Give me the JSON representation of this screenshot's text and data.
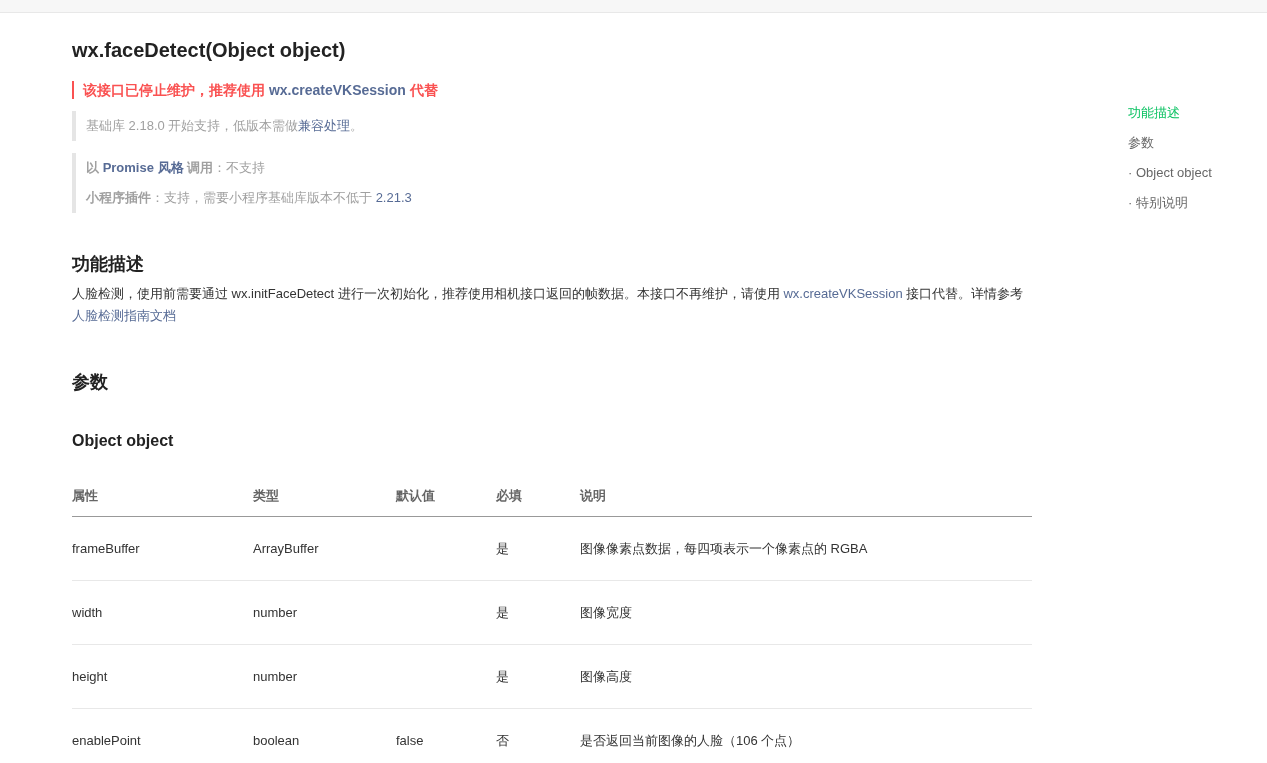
{
  "title": "wx.faceDetect(Object object)",
  "deprecation": [
    {
      "text": "该接口已停止维护，推荐使用 ",
      "kind": "text"
    },
    {
      "text": "wx.createVKSession",
      "kind": "link"
    },
    {
      "text": " 代替",
      "kind": "text"
    }
  ],
  "notes": [
    [
      [
        {
          "text": "基础库 2.18.0 开始支持，低版本需做",
          "kind": "text"
        },
        {
          "text": "兼容处理",
          "kind": "link"
        },
        {
          "text": "。",
          "kind": "text"
        }
      ]
    ],
    [
      [
        {
          "text": "以 ",
          "kind": "strong"
        },
        {
          "text": "Promise 风格",
          "kind": "strong-link"
        },
        {
          "text": " 调用",
          "kind": "strong"
        },
        {
          "text": "：不支持",
          "kind": "text"
        }
      ],
      [
        {
          "text": "小程序插件",
          "kind": "strong"
        },
        {
          "text": "：支持，需要小程序基础库版本不低于 ",
          "kind": "text"
        },
        {
          "text": "2.21.3",
          "kind": "link"
        }
      ]
    ]
  ],
  "description": {
    "heading": "功能描述",
    "paragraph": [
      {
        "text": "人脸检测，使用前需要通过 wx.initFaceDetect 进行一次初始化，推荐使用相机接口返回的帧数据。本接口不再维护，请使用 ",
        "kind": "text"
      },
      {
        "text": "wx.createVKSession",
        "kind": "link"
      },
      {
        "text": " 接口代替。详情参考",
        "kind": "text"
      },
      {
        "text": "人脸检测指南文档",
        "kind": "link"
      }
    ]
  },
  "params": {
    "heading": "参数",
    "subheading": "Object object",
    "table": {
      "columns": [
        "属性",
        "类型",
        "默认值",
        "必填",
        "说明"
      ],
      "rows": [
        [
          "frameBuffer",
          "ArrayBuffer",
          "",
          "是",
          "图像像素点数据，每四项表示一个像素点的 RGBA"
        ],
        [
          "width",
          "number",
          "",
          "是",
          "图像宽度"
        ],
        [
          "height",
          "number",
          "",
          "是",
          "图像高度"
        ],
        [
          "enablePoint",
          "boolean",
          "false",
          "否",
          "是否返回当前图像的人脸（106 个点）"
        ]
      ]
    }
  },
  "toc": [
    {
      "label": "功能描述",
      "selected": true
    },
    {
      "label": "参数",
      "selected": false
    },
    {
      "label": "· Object object",
      "selected": false
    },
    {
      "label": "· 特别说明",
      "selected": false
    }
  ]
}
